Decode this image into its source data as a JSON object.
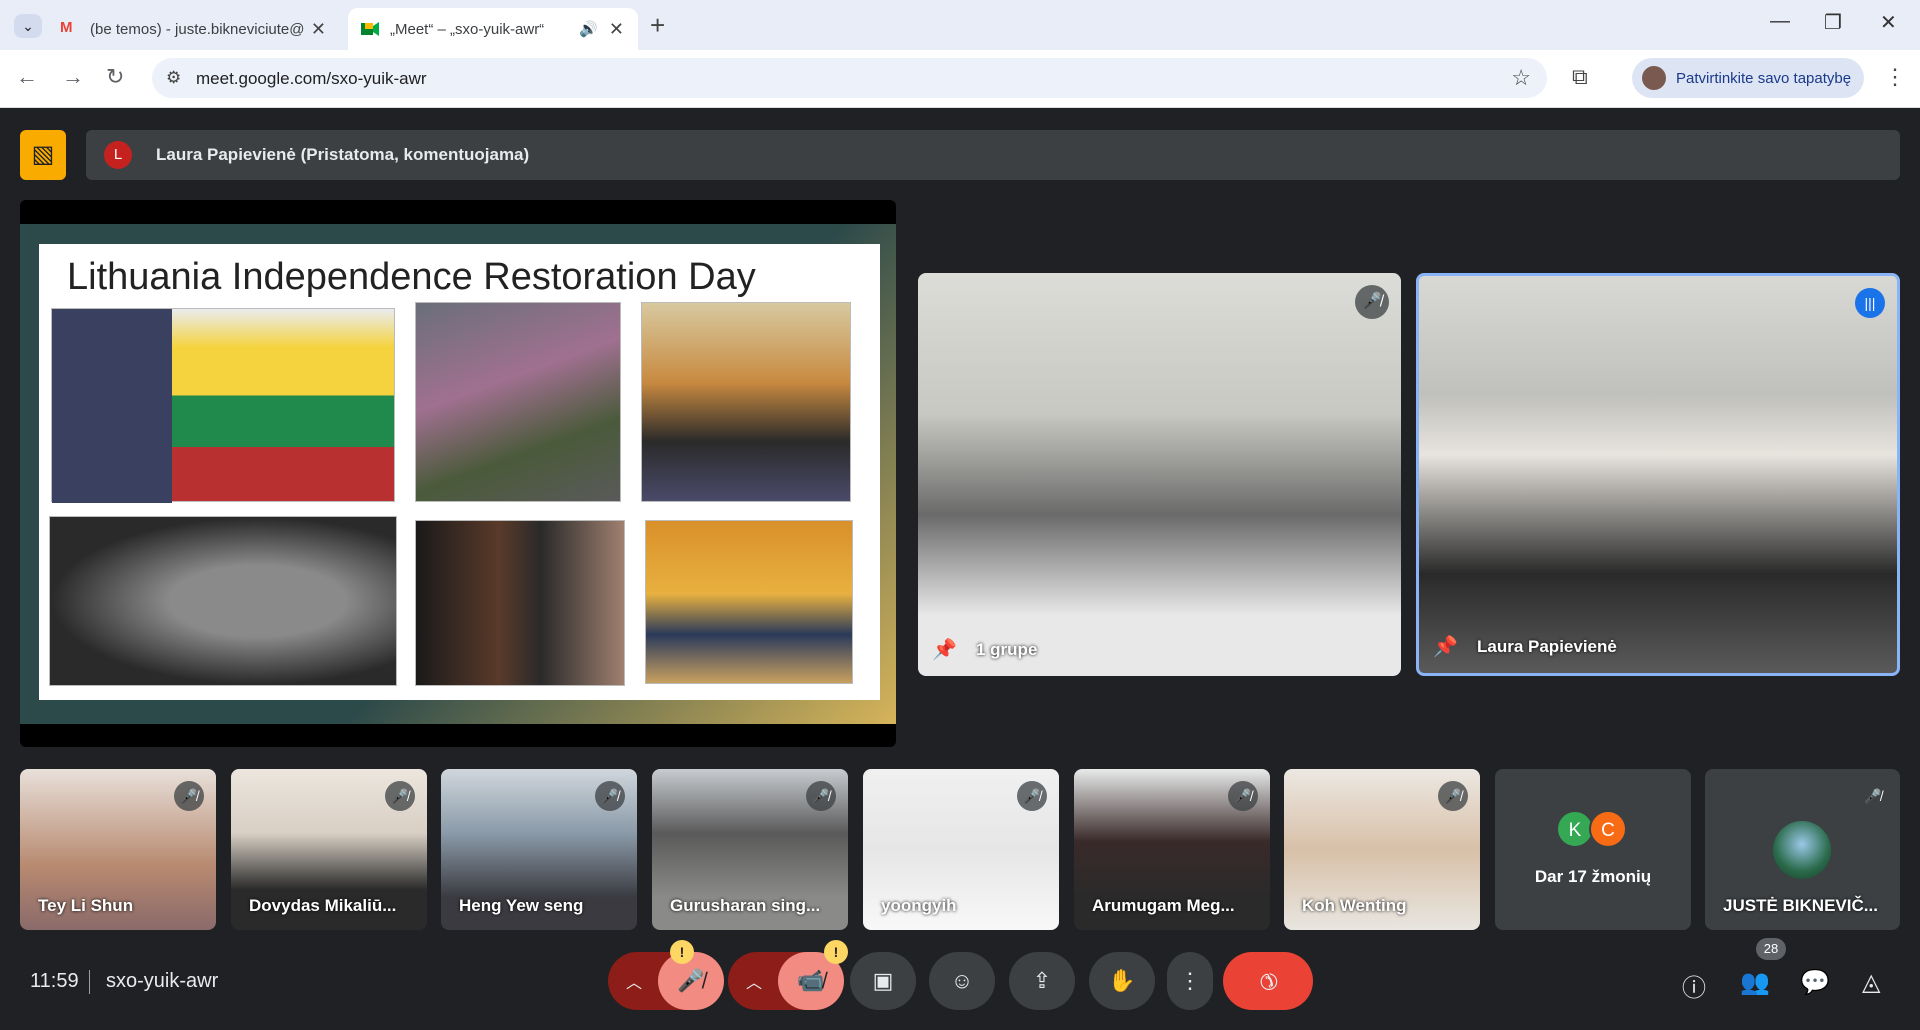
{
  "browser": {
    "tabs": [
      {
        "title": "(be temos) - juste.bikneviciute@",
        "close": "✕"
      },
      {
        "title": "„Meet“ – „sxo-yuik-awr“",
        "close": "✕"
      }
    ],
    "url": "meet.google.com/sxo-yuik-awr",
    "profile_label": "Patvirtinkite savo tapatybę"
  },
  "meeting": {
    "presenter_initial": "L",
    "presenter_label": "Laura Papievienė (Pristatoma, komentuojama)",
    "slide_title": "Lithuania Independence Restoration Day",
    "main_tiles": [
      {
        "name": "1 grupe"
      },
      {
        "name": "Laura Papievienė"
      }
    ],
    "participants": [
      {
        "name": "Tey Li Shun"
      },
      {
        "name": "Dovydas Mikaliū..."
      },
      {
        "name": "Heng Yew seng"
      },
      {
        "name": "Gurusharan sing..."
      },
      {
        "name": "yoongyih"
      },
      {
        "name": "Arumugam Meg..."
      },
      {
        "name": "Koh Wenting"
      }
    ],
    "others": {
      "initials": [
        "K",
        "C"
      ],
      "label": "Dar 17 žmonių"
    },
    "last_tile": {
      "name": "JUSTĖ BIKNEVIČ..."
    },
    "time": "11:59",
    "code": "sxo-yuik-awr",
    "people_count": "28",
    "warn_mark": "!"
  },
  "colors": {
    "end_call": "#ea4335",
    "mic_off_bg": "#f28b82",
    "accent": "#1a73e8"
  }
}
